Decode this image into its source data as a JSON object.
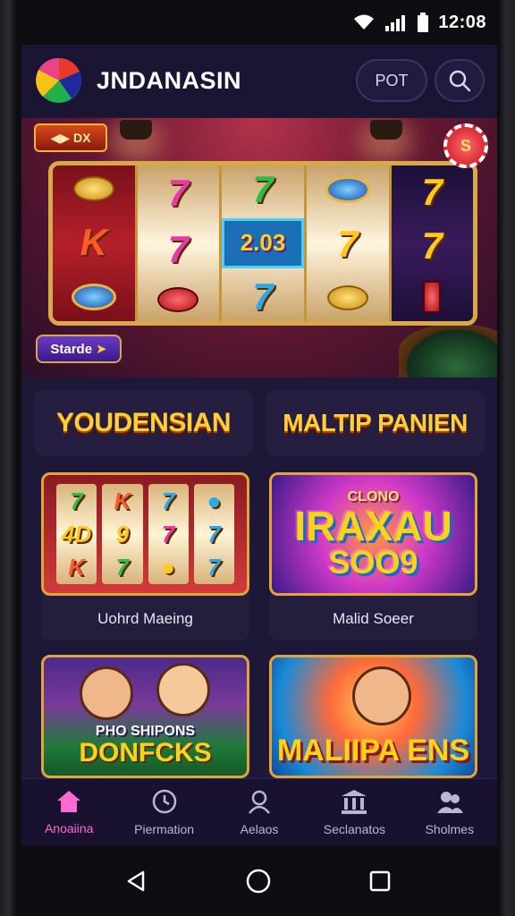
{
  "status_bar": {
    "time": "12:08"
  },
  "header": {
    "title": "JNDANASIN",
    "pot_label": "POT"
  },
  "hero": {
    "badge_label": "DX",
    "chip_label": "S",
    "center_text": "2.03",
    "start_label": "Starde",
    "reels": [
      [
        "coin",
        "K",
        "gem"
      ],
      [
        "7",
        "7",
        "bar"
      ],
      [
        "7",
        "center",
        "7"
      ],
      [
        "gem",
        "7",
        "coin"
      ],
      [
        "7",
        "7",
        "bar"
      ]
    ]
  },
  "categories": [
    {
      "label": "YOUDENSIAN"
    },
    {
      "label": "MALTIP PANIEN"
    }
  ],
  "games": [
    {
      "label": "Uohrd Maeing",
      "thumb_text": ""
    },
    {
      "label": "Malid Soeer",
      "thumb_text": "IRAXAU",
      "thumb_sub": "SOO9",
      "thumb_top": "CLONO"
    },
    {
      "label": "",
      "thumb_text": "DONFCKS",
      "thumb_sub": "PHO SHIPONS"
    },
    {
      "label": "",
      "thumb_text": "MALIIPA ENS"
    }
  ],
  "tabbar": {
    "items": [
      {
        "label": "Anoaiina",
        "icon": "home-icon",
        "active": true
      },
      {
        "label": "Piermation",
        "icon": "clock-icon",
        "active": false
      },
      {
        "label": "Aelaos",
        "icon": "user-icon",
        "active": false
      },
      {
        "label": "Seclanatos",
        "icon": "bank-icon",
        "active": false
      },
      {
        "label": "Sholmes",
        "icon": "group-icon",
        "active": false
      }
    ]
  },
  "colors": {
    "accent": "#ff6ad0",
    "background": "#1e1838",
    "gold": "#ffcf3a"
  }
}
